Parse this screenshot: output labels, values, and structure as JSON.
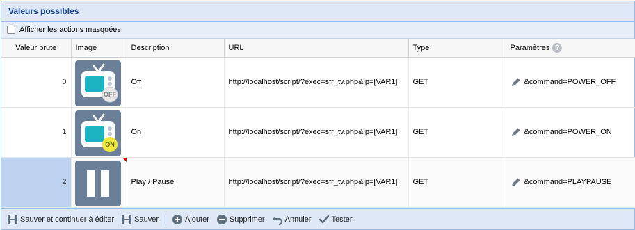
{
  "panel": {
    "title": "Valeurs possibles"
  },
  "toolbar": {
    "show_hidden_label": "Afficher les actions masquées"
  },
  "columns": {
    "raw_value": "Valeur brute",
    "image": "Image",
    "description": "Description",
    "url": "URL",
    "type": "Type",
    "params": "Paramètres"
  },
  "rows": [
    {
      "value": "0",
      "image_badge": "OFF",
      "description": "Off",
      "url": "http://localhost/script/?exec=sfr_tv.php&ip=[VAR1]",
      "type": "GET",
      "params": "&command=POWER_OFF"
    },
    {
      "value": "1",
      "image_badge": "ON",
      "description": "On",
      "url": "http://localhost/script/?exec=sfr_tv.php&ip=[VAR1]",
      "type": "GET",
      "params": "&command=POWER_ON"
    },
    {
      "value": "2",
      "image_badge": "",
      "description": "Play / Pause",
      "url": "http://localhost/script/?exec=sfr_tv.php&ip=[VAR1]",
      "type": "GET",
      "params": "&command=PLAYPAUSE"
    }
  ],
  "bottombar": {
    "save_continue": "Sauver et continuer à éditer",
    "save": "Sauver",
    "add": "Ajouter",
    "delete": "Supprimer",
    "cancel": "Annuler",
    "test": "Tester"
  },
  "colors": {
    "header_text": "#15428b",
    "icon_tile": "#6b7f99",
    "tv_screen": "#1ab3c0",
    "on_badge": "#f0e640"
  }
}
